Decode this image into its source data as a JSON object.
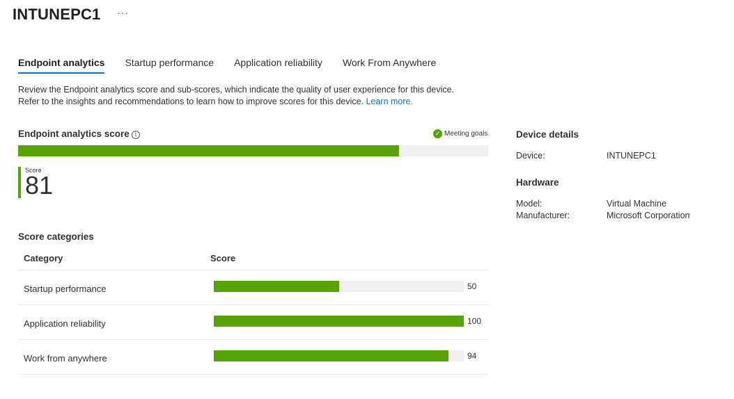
{
  "header": {
    "title": "INTUNEPC1",
    "more": "···"
  },
  "tabs": [
    {
      "label": "Endpoint analytics",
      "active": true
    },
    {
      "label": "Startup performance",
      "active": false
    },
    {
      "label": "Application reliability",
      "active": false
    },
    {
      "label": "Work From Anywhere",
      "active": false
    }
  ],
  "description": {
    "line1": "Review the Endpoint analytics score and sub-scores, which indicate the quality of user experience for this device.",
    "line2": "Refer to the insights and recommendations to learn how to improve scores for this device. ",
    "link": "Learn more."
  },
  "score_section": {
    "title": "Endpoint analytics score",
    "info_icon": "i",
    "status": "Meeting goals",
    "status_icon": "✓",
    "score_label": "Score",
    "score": 81,
    "score_max": 100
  },
  "categories": {
    "title": "Score categories",
    "col_category": "Category",
    "col_score": "Score",
    "rows": [
      {
        "name": "Startup performance",
        "score": 50
      },
      {
        "name": "Application reliability",
        "score": 100
      },
      {
        "name": "Work from anywhere",
        "score": 94
      }
    ]
  },
  "device_details": {
    "title": "Device details",
    "device_label": "Device:",
    "device_value": "INTUNEPC1"
  },
  "hardware": {
    "title": "Hardware",
    "model_label": "Model:",
    "model_value": "Virtual Machine",
    "manufacturer_label": "Manufacturer:",
    "manufacturer_value": "Microsoft Corporation"
  },
  "colors": {
    "accent": "#0078d4",
    "success": "#57a300",
    "track": "#f0f0f0"
  }
}
